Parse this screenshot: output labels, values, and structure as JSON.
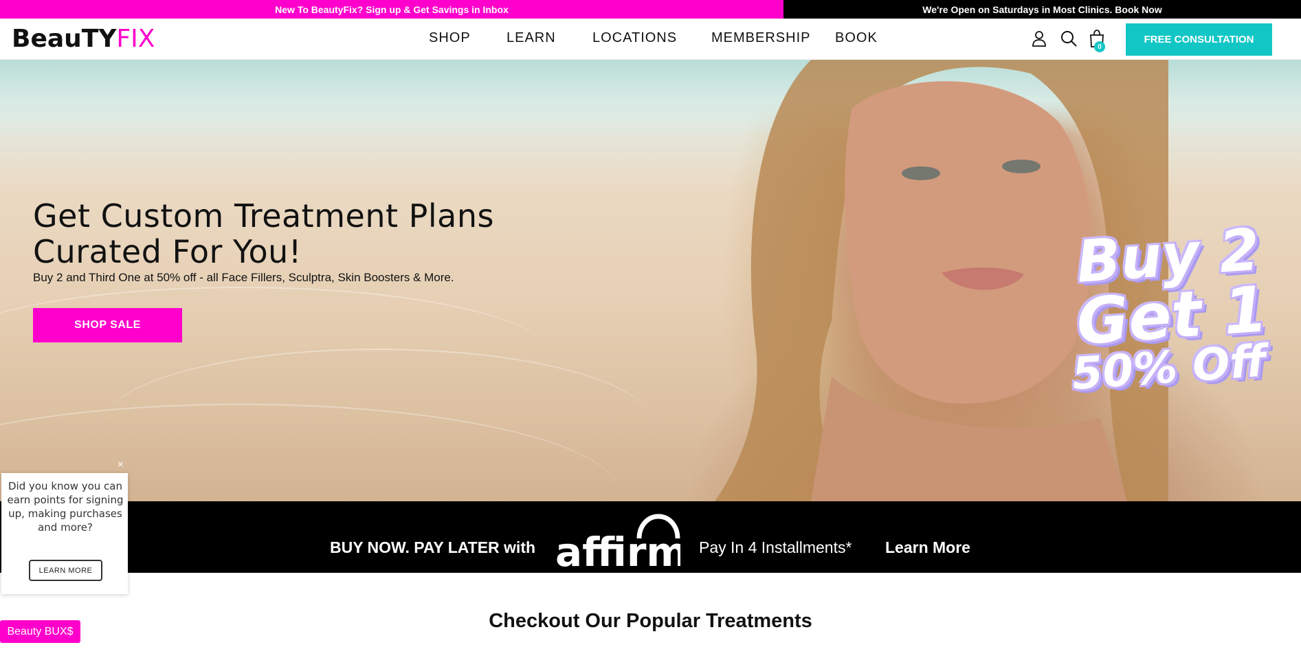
{
  "announcement": {
    "left_text": "New To BeautyFix? Sign up & Get Savings in Inbox",
    "right_text": "We're Open on Saturdays in Most Clinics. Book Now",
    "left_color": "#ff00cc",
    "right_color": "#000000"
  },
  "header": {
    "logo": {
      "part1": "BeauTY",
      "part2": "FIX"
    },
    "nav": [
      "SHOP",
      "LEARN",
      "LOCATIONS",
      "MEMBERSHIP",
      "BOOK"
    ],
    "icons": [
      "user-icon",
      "search-icon",
      "shopping-bag-icon"
    ],
    "cart_count": "0",
    "cta": "FREE CONSULTATION",
    "cta_color": "#13c6c6"
  },
  "hero": {
    "title": "Get Custom Treatment Plans Curated For You!",
    "subtitle": "Buy 2 and Third One at 50% off - all Face Fillers, Sculptra, Skin Boosters & More.",
    "button": "SHOP SALE",
    "promo": {
      "line1": "Buy 2",
      "line2": "Get 1",
      "line3": "50% Off"
    }
  },
  "affirm": {
    "lead": "BUY NOW. PAY LATER with",
    "logo": "affirm",
    "installments": "Pay In 4 Installments*",
    "link": "Learn More"
  },
  "section": {
    "title": "Checkout Our Popular Treatments"
  },
  "popup": {
    "text": "Did you know you can earn points for signing up, making purchases and more?",
    "button": "LEARN MORE",
    "close": "×"
  },
  "rewards_tab": {
    "label": "Beauty BUX$"
  }
}
